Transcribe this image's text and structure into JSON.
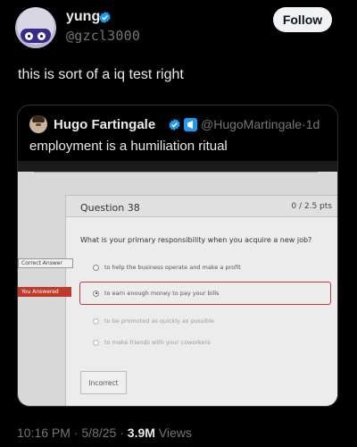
{
  "post": {
    "author_name": "yung",
    "author_handle": "@gzcl3000",
    "follow_label": "Follow",
    "text": "this is sort of a iq test right",
    "time": "10:16 PM",
    "date": "5/8/25",
    "views_count": "3.9M",
    "views_label": "Views",
    "separator": "·"
  },
  "quote": {
    "author_name": "Hugo Fartingale",
    "author_handle": "@HugoMartingale",
    "age": "1d",
    "text": "employment is a humiliation ritual"
  },
  "quiz": {
    "question_number": "Question 38",
    "points": "0 / 2.5 pts",
    "prompt": "What is your primary responsibility when you acquire a new job?",
    "correct_label": "Correct Answer",
    "answered_label": "You Answered",
    "options": [
      "to help the business operate and make a profit",
      "to earn enough money to pay your bills",
      "to be promoted as quickly as possible",
      "to make friends with your coworkers"
    ],
    "result": "Incorrect"
  },
  "colors": {
    "verified_blue": "#1d9bf0",
    "muted_text": "#71767b",
    "wrong_red": "#c0392b"
  },
  "icons": [
    "verified-badge-icon",
    "affiliate-badge-icon",
    "radio-icon"
  ]
}
